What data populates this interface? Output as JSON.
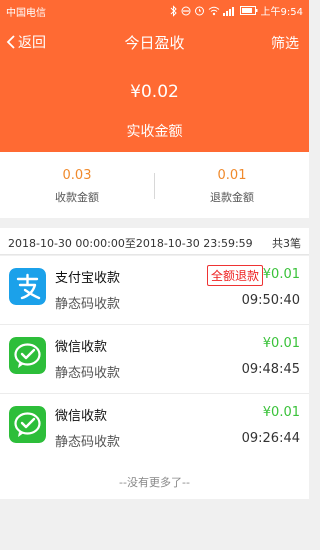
{
  "status_bar": {
    "carrier": "中国电信",
    "time": "上午9:54"
  },
  "nav": {
    "back_label": "返回",
    "title": "今日盈收",
    "filter_label": "筛选"
  },
  "hero": {
    "amount": "¥0.02",
    "label": "实收金额"
  },
  "summary": {
    "collected_value": "0.03",
    "collected_label": "收款金额",
    "refund_value": "0.01",
    "refund_label": "退款金额"
  },
  "range": {
    "text": "2018-10-30 00:00:00至2018-10-30 23:59:59",
    "count": "共3笔"
  },
  "transactions": [
    {
      "icon": "alipay-icon",
      "name": "支付宝收款",
      "sub": "静态码收款",
      "badge": "全额退款",
      "amount": "¥0.01",
      "time": "09:50:40"
    },
    {
      "icon": "wechat-pay-icon",
      "name": "微信收款",
      "sub": "静态码收款",
      "amount": "¥0.01",
      "time": "09:48:45"
    },
    {
      "icon": "wechat-pay-icon",
      "name": "微信收款",
      "sub": "静态码收款",
      "amount": "¥0.01",
      "time": "09:26:44"
    }
  ],
  "footer": {
    "no_more": "--没有更多了--"
  },
  "colors": {
    "brand": "#ff6a33",
    "summary_value": "#f08a2c",
    "amount_green": "#3ac23a",
    "refund_red": "#e22222",
    "alipay_blue": "#1ba1ea",
    "wechat_green": "#2dbe3a"
  }
}
